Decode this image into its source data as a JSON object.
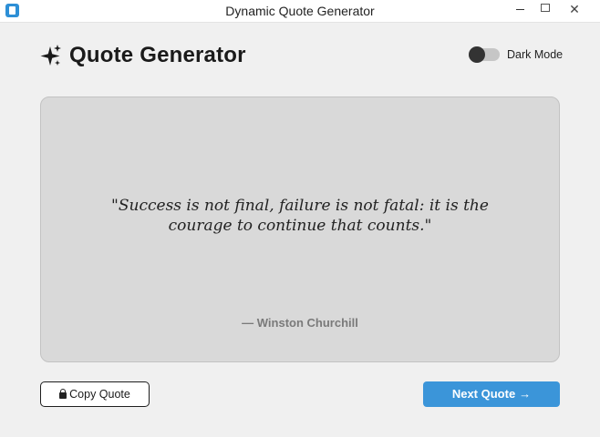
{
  "window": {
    "title": "Dynamic Quote Generator",
    "app_icon": "notepad-icon",
    "controls": {
      "minimize": "minimize-icon",
      "maximize": "maximize-icon",
      "close": "✕"
    }
  },
  "header": {
    "icon": "sparkles-icon",
    "title": "Quote Generator",
    "dark_mode_label": "Dark Mode",
    "dark_mode_on": false
  },
  "quote": {
    "text": "\"Success is not final, failure is not fatal: it is the courage to continue that counts.\"",
    "author": "— Winston Churchill"
  },
  "actions": {
    "copy_label": "Copy Quote",
    "copy_icon": "lock-icon",
    "next_label": "Next Quote",
    "next_arrow": "→"
  },
  "colors": {
    "background": "#f0f0f0",
    "card": "#d9d9d9",
    "accent": "#3b95d9",
    "author": "#7a7a7a"
  }
}
